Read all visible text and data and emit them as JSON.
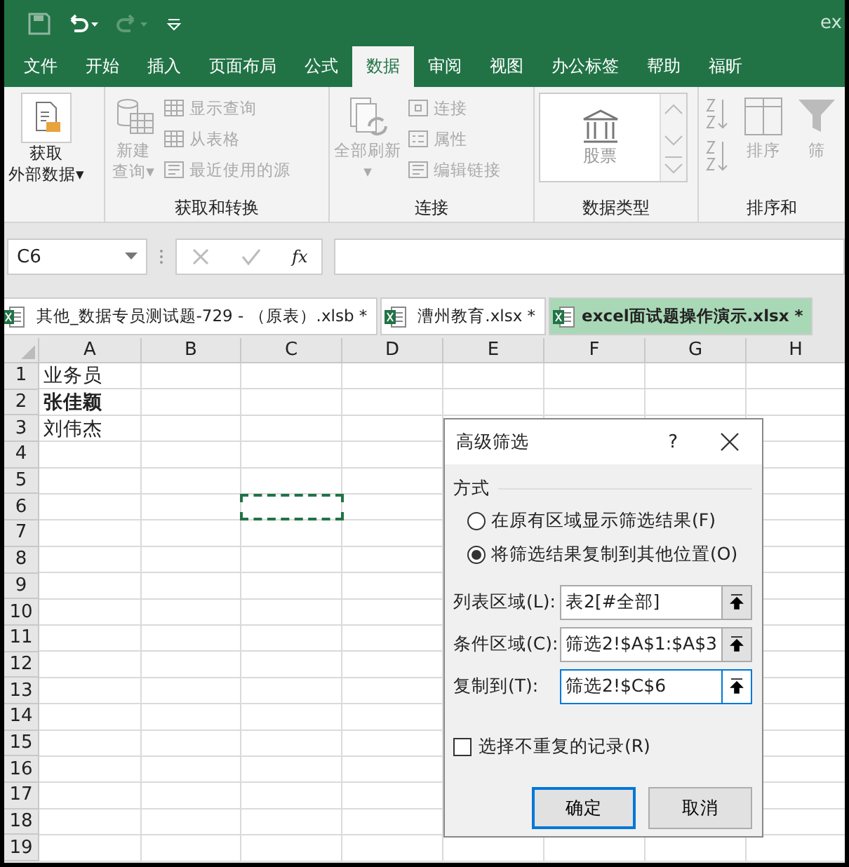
{
  "title_bar": {
    "title": "ex"
  },
  "ribbon_tabs": [
    {
      "label": "文件",
      "selected": false
    },
    {
      "label": "开始",
      "selected": false
    },
    {
      "label": "插入",
      "selected": false
    },
    {
      "label": "页面布局",
      "selected": false
    },
    {
      "label": "公式",
      "selected": false
    },
    {
      "label": "数据",
      "selected": true
    },
    {
      "label": "审阅",
      "selected": false
    },
    {
      "label": "视图",
      "selected": false
    },
    {
      "label": "办公标签",
      "selected": false
    },
    {
      "label": "帮助",
      "selected": false
    },
    {
      "label": "福昕",
      "selected": false
    }
  ],
  "ribbon_groups": [
    {
      "items": [
        {
          "kind": "large",
          "lines": [
            "获取",
            "外部数据▾"
          ],
          "disabled": false
        }
      ]
    },
    {
      "label": "获取和转换",
      "items": [
        {
          "kind": "large",
          "lines": [
            "新建",
            "查询▾"
          ],
          "disabled": true
        },
        {
          "kind": "small",
          "label": "显示查询",
          "disabled": true
        },
        {
          "kind": "small",
          "label": "从表格",
          "disabled": true
        },
        {
          "kind": "small",
          "label": "最近使用的源",
          "disabled": true
        }
      ]
    },
    {
      "label": "连接",
      "items": [
        {
          "kind": "large",
          "lines": [
            "全部刷新",
            "▾"
          ],
          "disabled": true
        },
        {
          "kind": "small",
          "label": "连接",
          "disabled": true
        },
        {
          "kind": "small",
          "label": "属性",
          "disabled": true
        },
        {
          "kind": "small",
          "label": "编辑链接",
          "disabled": true
        }
      ]
    },
    {
      "label": "数据类型",
      "items": [
        {
          "kind": "gallery",
          "label": "股票",
          "disabled": false
        }
      ]
    },
    {
      "label": "排序和",
      "items": [
        {
          "kind": "sort",
          "disabled": true
        },
        {
          "kind": "large",
          "lines": [
            "排序"
          ],
          "disabled": true
        },
        {
          "kind": "large",
          "lines": [
            "筛"
          ],
          "disabled": true
        }
      ]
    }
  ],
  "formula_bar": {
    "name_box": "C6",
    "function_label": "fx"
  },
  "file_tabs": [
    {
      "label": "其他_数据专员测试题-729 - （原表）.xlsb *",
      "selected": false
    },
    {
      "label": "漕州教育.xlsx *",
      "selected": false
    },
    {
      "label": "excel面试题操作演示.xlsx *",
      "selected": true
    }
  ],
  "sheet": {
    "columns": [
      "A",
      "B",
      "C",
      "D",
      "E",
      "F",
      "G",
      "H"
    ],
    "rows": [
      {
        "number": "1",
        "a": "业务员",
        "bold": false
      },
      {
        "number": "2",
        "a": "张佳颖",
        "bold": true
      },
      {
        "number": "3",
        "a": "刘伟杰",
        "bold": false
      },
      {
        "number": "4"
      },
      {
        "number": "5"
      },
      {
        "number": "6",
        "marquee": true
      },
      {
        "number": "7"
      },
      {
        "number": "8"
      },
      {
        "number": "9"
      },
      {
        "number": "10"
      },
      {
        "number": "11"
      },
      {
        "number": "12"
      },
      {
        "number": "13"
      },
      {
        "number": "14"
      },
      {
        "number": "15"
      },
      {
        "number": "16"
      },
      {
        "number": "17"
      },
      {
        "number": "18"
      },
      {
        "number": "19"
      }
    ]
  },
  "dialog": {
    "title": "高级筛选",
    "help": "?",
    "section": "方式",
    "radios": [
      {
        "label": "在原有区域显示筛选结果(F)",
        "selected": false
      },
      {
        "label": "将筛选结果复制到其他位置(O)",
        "selected": true
      }
    ],
    "fields": [
      {
        "label": "列表区域(L):",
        "value": "表2[#全部]",
        "focused": false
      },
      {
        "label": "条件区域(C):",
        "value": "筛选2!$A$1:$A$3",
        "focused": false
      },
      {
        "label": "复制到(T):",
        "value": "筛选2!$C$6",
        "focused": true
      }
    ],
    "checkbox": {
      "label": "选择不重复的记录(R)",
      "checked": false
    },
    "buttons": [
      {
        "label": "确定",
        "default": true
      },
      {
        "label": "取消",
        "default": false
      }
    ]
  }
}
